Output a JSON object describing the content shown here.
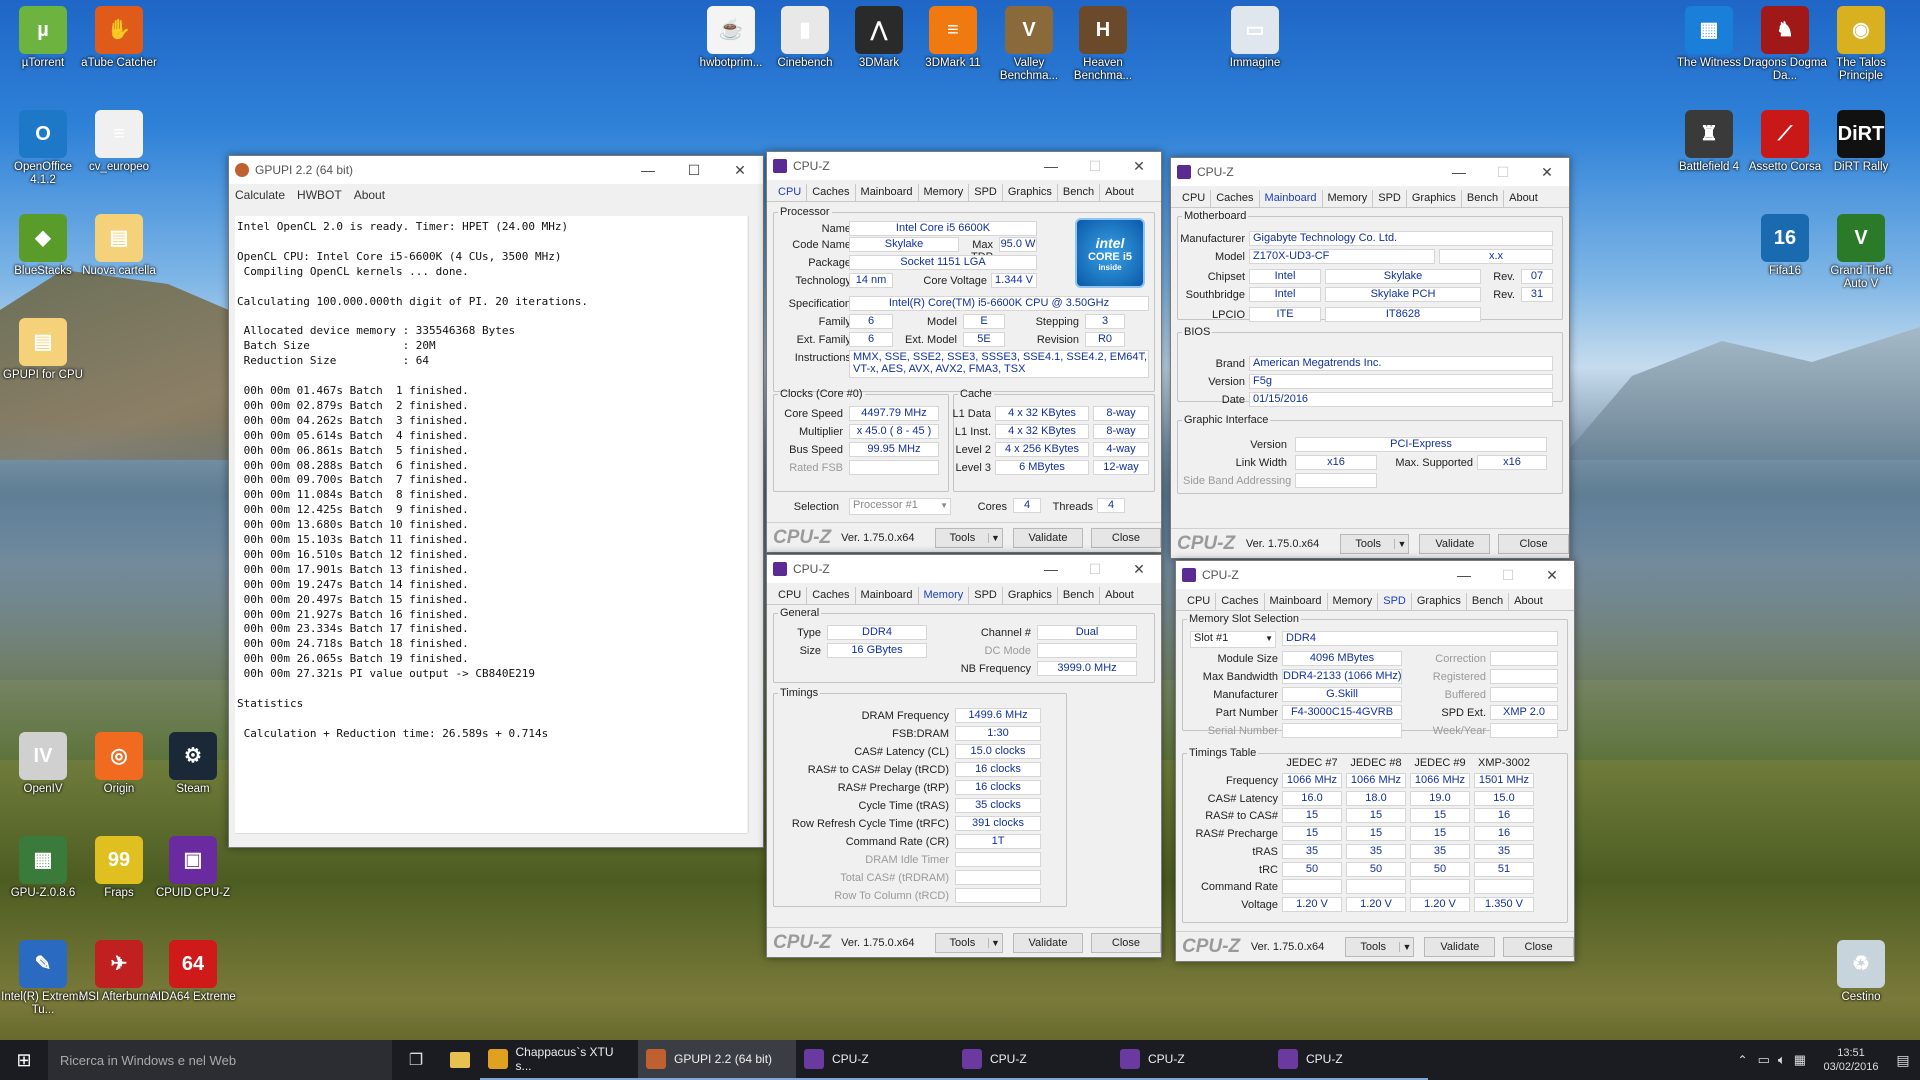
{
  "desktop_icons": [
    {
      "label": "µTorrent",
      "color": "#6cb33f",
      "glyph": "µ"
    },
    {
      "label": "aTube Catcher",
      "color": "#e05a1a",
      "glyph": "✋"
    },
    {
      "label": "OpenOffice 4.1.2",
      "color": "#1e78c8",
      "glyph": "O"
    },
    {
      "label": "cv_europeo",
      "color": "#f0f0f0",
      "glyph": "≡"
    },
    {
      "label": "BlueStacks",
      "color": "#5a9c2a",
      "glyph": "◆"
    },
    {
      "label": "Nuova cartella",
      "color": "#f5d27a",
      "glyph": "▤"
    },
    {
      "label": "GPUPI for CPU",
      "color": "#f5d27a",
      "glyph": "▤"
    },
    {
      "label": "hwbotprim...",
      "color": "#f4f4f4",
      "glyph": "☕"
    },
    {
      "label": "Cinebench",
      "color": "#e8e8e8",
      "glyph": "▮"
    },
    {
      "label": "3DMark",
      "color": "#2a2a2a",
      "glyph": "⋀"
    },
    {
      "label": "3DMark 11",
      "color": "#f07a10",
      "glyph": "≡"
    },
    {
      "label": "Valley Benchma...",
      "color": "#8a6a3a",
      "glyph": "V"
    },
    {
      "label": "Heaven Benchma...",
      "color": "#6a4a2a",
      "glyph": "H"
    },
    {
      "label": "Immagine",
      "color": "#dfe6ee",
      "glyph": "▭"
    },
    {
      "label": "The Witness",
      "color": "#1a7fd8",
      "glyph": "▦"
    },
    {
      "label": "Dragons Dogma Da...",
      "color": "#a01818",
      "glyph": "♞"
    },
    {
      "label": "The Talos Principle",
      "color": "#d8b020",
      "glyph": "◉"
    },
    {
      "label": "Battlefield 4",
      "color": "#3a3a3a",
      "glyph": "♜"
    },
    {
      "label": "Assetto Corsa",
      "color": "#c81818",
      "glyph": "⟋"
    },
    {
      "label": "DiRT Rally",
      "color": "#111",
      "glyph": "DiRT"
    },
    {
      "label": "Fifa16",
      "color": "#1a6ab0",
      "glyph": "16"
    },
    {
      "label": "Grand Theft Auto V",
      "color": "#2a7a2a",
      "glyph": "V"
    },
    {
      "label": "OpenIV",
      "color": "#d0d0d0",
      "glyph": "IV"
    },
    {
      "label": "Origin",
      "color": "#f06a20",
      "glyph": "◎"
    },
    {
      "label": "Steam",
      "color": "#1b2838",
      "glyph": "⚙"
    },
    {
      "label": "GPU-Z.0.8.6",
      "color": "#3a7a3a",
      "glyph": "▦"
    },
    {
      "label": "Fraps",
      "color": "#e0c020",
      "glyph": "99"
    },
    {
      "label": "CPUID CPU-Z",
      "color": "#6a2aa0",
      "glyph": "▣"
    },
    {
      "label": "Intel(R) Extreme Tu...",
      "color": "#2a6ac0",
      "glyph": "✎"
    },
    {
      "label": "MSI Afterburner",
      "color": "#c02020",
      "glyph": "✈"
    },
    {
      "label": "AIDA64 Extreme",
      "color": "#d01a1a",
      "glyph": "64"
    },
    {
      "label": "Cestino",
      "color": "#c8d4dc",
      "glyph": "♻"
    }
  ],
  "gpupi": {
    "title": "GPUPI 2.2 (64 bit)",
    "menu": [
      "Calculate",
      "HWBOT",
      "About"
    ],
    "output": "Intel OpenCL 2.0 is ready. Timer: HPET (24.00 MHz)\n\nOpenCL CPU: Intel Core i5-6600K (4 CUs, 3500 MHz)\n Compiling OpenCL kernels ... done.\n\nCalculating 100.000.000th digit of PI. 20 iterations.\n\n Allocated device memory : 335546368 Bytes\n Batch Size              : 20M\n Reduction Size          : 64\n\n 00h 00m 01.467s Batch  1 finished.\n 00h 00m 02.879s Batch  2 finished.\n 00h 00m 04.262s Batch  3 finished.\n 00h 00m 05.614s Batch  4 finished.\n 00h 00m 06.861s Batch  5 finished.\n 00h 00m 08.288s Batch  6 finished.\n 00h 00m 09.700s Batch  7 finished.\n 00h 00m 11.084s Batch  8 finished.\n 00h 00m 12.425s Batch  9 finished.\n 00h 00m 13.680s Batch 10 finished.\n 00h 00m 15.103s Batch 11 finished.\n 00h 00m 16.510s Batch 12 finished.\n 00h 00m 17.901s Batch 13 finished.\n 00h 00m 19.247s Batch 14 finished.\n 00h 00m 20.497s Batch 15 finished.\n 00h 00m 21.927s Batch 16 finished.\n 00h 00m 23.334s Batch 17 finished.\n 00h 00m 24.718s Batch 18 finished.\n 00h 00m 26.065s Batch 19 finished.\n 00h 00m 27.321s PI value output -> CB840E219\n\nStatistics\n\n Calculation + Reduction time: 26.589s + 0.714s"
  },
  "cpuz_common": {
    "title": "CPU-Z",
    "tabs": [
      "CPU",
      "Caches",
      "Mainboard",
      "Memory",
      "SPD",
      "Graphics",
      "Bench",
      "About"
    ],
    "brand": "CPU-Z",
    "version": "Ver. 1.75.0.x64",
    "tools": "Tools",
    "validate": "Validate",
    "close": "Close"
  },
  "cpu": {
    "processor_legend": "Processor",
    "name_l": "Name",
    "name": "Intel Core i5 6600K",
    "code_l": "Code Name",
    "code": "Skylake",
    "tdp_l": "Max TDP",
    "tdp": "95.0 W",
    "pkg_l": "Package",
    "pkg": "Socket 1151 LGA",
    "tech_l": "Technology",
    "tech": "14 nm",
    "cv_l": "Core Voltage",
    "cv": "1.344 V",
    "spec_l": "Specification",
    "spec": "Intel(R) Core(TM) i5-6600K CPU @ 3.50GHz",
    "fam_l": "Family",
    "fam": "6",
    "model_l": "Model",
    "model": "E",
    "step_l": "Stepping",
    "step": "3",
    "efam_l": "Ext. Family",
    "efam": "6",
    "emodel_l": "Ext. Model",
    "emodel": "5E",
    "rev_l": "Revision",
    "rev": "R0",
    "instr_l": "Instructions",
    "instr": "MMX, SSE, SSE2, SSE3, SSSE3, SSE4.1, SSE4.2, EM64T, VT-x, AES, AVX, AVX2, FMA3, TSX",
    "intel_logo": [
      "intel",
      "CORE i5",
      "inside"
    ],
    "clocks_legend": "Clocks (Core #0)",
    "cs_l": "Core Speed",
    "cs": "4497.79 MHz",
    "mul_l": "Multiplier",
    "mul": "x 45.0 ( 8 - 45 )",
    "bus_l": "Bus Speed",
    "bus": "99.95 MHz",
    "fsb_l": "Rated FSB",
    "fsb": "",
    "cache_legend": "Cache",
    "l1d_l": "L1 Data",
    "l1d": "4 x 32 KBytes",
    "l1d_w": "8-way",
    "l1i_l": "L1 Inst.",
    "l1i": "4 x 32 KBytes",
    "l1i_w": "8-way",
    "l2_l": "Level 2",
    "l2": "4 x 256 KBytes",
    "l2_w": "4-way",
    "l3_l": "Level 3",
    "l3": "6 MBytes",
    "l3_w": "12-way",
    "sel_l": "Selection",
    "sel": "Processor #1",
    "cores_l": "Cores",
    "cores": "4",
    "thr_l": "Threads",
    "thr": "4"
  },
  "mainboard": {
    "mb_legend": "Motherboard",
    "man_l": "Manufacturer",
    "man": "Gigabyte Technology Co. Ltd.",
    "model_l": "Model",
    "model": "Z170X-UD3-CF",
    "model_rev": "x.x",
    "chip_l": "Chipset",
    "chip_v": "Intel",
    "chip_n": "Skylake",
    "chip_rl": "Rev.",
    "chip_r": "07",
    "sb_l": "Southbridge",
    "sb_v": "Intel",
    "sb_n": "Skylake PCH",
    "sb_rl": "Rev.",
    "sb_r": "31",
    "lpc_l": "LPCIO",
    "lpc_v": "ITE",
    "lpc_n": "IT8628",
    "bios_legend": "BIOS",
    "brand_l": "Brand",
    "brand": "American Megatrends Inc.",
    "ver_l": "Version",
    "ver": "F5g",
    "date_l": "Date",
    "date": "01/15/2016",
    "gi_legend": "Graphic Interface",
    "gv_l": "Version",
    "gv": "PCI-Express",
    "lw_l": "Link Width",
    "lw": "x16",
    "ms_l": "Max. Supported",
    "ms": "x16",
    "sba_l": "Side Band Addressing"
  },
  "memory": {
    "gen_legend": "General",
    "type_l": "Type",
    "type": "DDR4",
    "ch_l": "Channel #",
    "ch": "Dual",
    "size_l": "Size",
    "size": "16 GBytes",
    "dc_l": "DC Mode",
    "dc": "",
    "nb_l": "NB Frequency",
    "nb": "3999.0 MHz",
    "tim_legend": "Timings",
    "rows": [
      {
        "l": "DRAM Frequency",
        "v": "1499.6 MHz"
      },
      {
        "l": "FSB:DRAM",
        "v": "1:30"
      },
      {
        "l": "CAS# Latency (CL)",
        "v": "15.0 clocks"
      },
      {
        "l": "RAS# to CAS# Delay (tRCD)",
        "v": "16 clocks"
      },
      {
        "l": "RAS# Precharge (tRP)",
        "v": "16 clocks"
      },
      {
        "l": "Cycle Time (tRAS)",
        "v": "35 clocks"
      },
      {
        "l": "Row Refresh Cycle Time (tRFC)",
        "v": "391 clocks"
      },
      {
        "l": "Command Rate (CR)",
        "v": "1T"
      },
      {
        "l": "DRAM Idle Timer",
        "v": ""
      },
      {
        "l": "Total CAS# (tRDRAM)",
        "v": ""
      },
      {
        "l": "Row To Column (tRCD)",
        "v": ""
      }
    ]
  },
  "spd": {
    "slot_legend": "Memory Slot Selection",
    "slot": "Slot #1",
    "slot_type": "DDR4",
    "ms_l": "Module Size",
    "ms": "4096 MBytes",
    "corr_l": "Correction",
    "mb_l": "Max Bandwidth",
    "mb": "DDR4-2133 (1066 MHz)",
    "reg_l": "Registered",
    "man_l": "Manufacturer",
    "man": "G.Skill",
    "buf_l": "Buffered",
    "pn_l": "Part Number",
    "pn": "F4-3000C15-4GVRB",
    "ext_l": "SPD Ext.",
    "ext": "XMP 2.0",
    "sn_l": "Serial Number",
    "wy_l": "Week/Year",
    "tt_legend": "Timings Table",
    "cols": [
      "JEDEC #7",
      "JEDEC #8",
      "JEDEC #9",
      "XMP-3002"
    ],
    "rows": [
      {
        "l": "Frequency",
        "v": [
          "1066 MHz",
          "1066 MHz",
          "1066 MHz",
          "1501 MHz"
        ]
      },
      {
        "l": "CAS# Latency",
        "v": [
          "16.0",
          "18.0",
          "19.0",
          "15.0"
        ]
      },
      {
        "l": "RAS# to CAS#",
        "v": [
          "15",
          "15",
          "15",
          "16"
        ]
      },
      {
        "l": "RAS# Precharge",
        "v": [
          "15",
          "15",
          "15",
          "16"
        ]
      },
      {
        "l": "tRAS",
        "v": [
          "35",
          "35",
          "35",
          "35"
        ]
      },
      {
        "l": "tRC",
        "v": [
          "50",
          "50",
          "50",
          "51"
        ]
      },
      {
        "l": "Command Rate",
        "v": [
          "",
          "",
          "",
          ""
        ]
      },
      {
        "l": "Voltage",
        "v": [
          "1.20 V",
          "1.20 V",
          "1.20 V",
          "1.350 V"
        ]
      }
    ]
  },
  "taskbar": {
    "search": "Ricerca in Windows e nel Web",
    "items": [
      {
        "label": "Chappacus`s XTU s...",
        "color": "#e0a020"
      },
      {
        "label": "GPUPI 2.2 (64 bit)",
        "color": "#c06030"
      },
      {
        "label": "CPU-Z",
        "color": "#6a3aa0"
      },
      {
        "label": "CPU-Z",
        "color": "#6a3aa0"
      },
      {
        "label": "CPU-Z",
        "color": "#6a3aa0"
      },
      {
        "label": "CPU-Z",
        "color": "#6a3aa0"
      }
    ],
    "time": "13:51",
    "date": "03/02/2016"
  }
}
